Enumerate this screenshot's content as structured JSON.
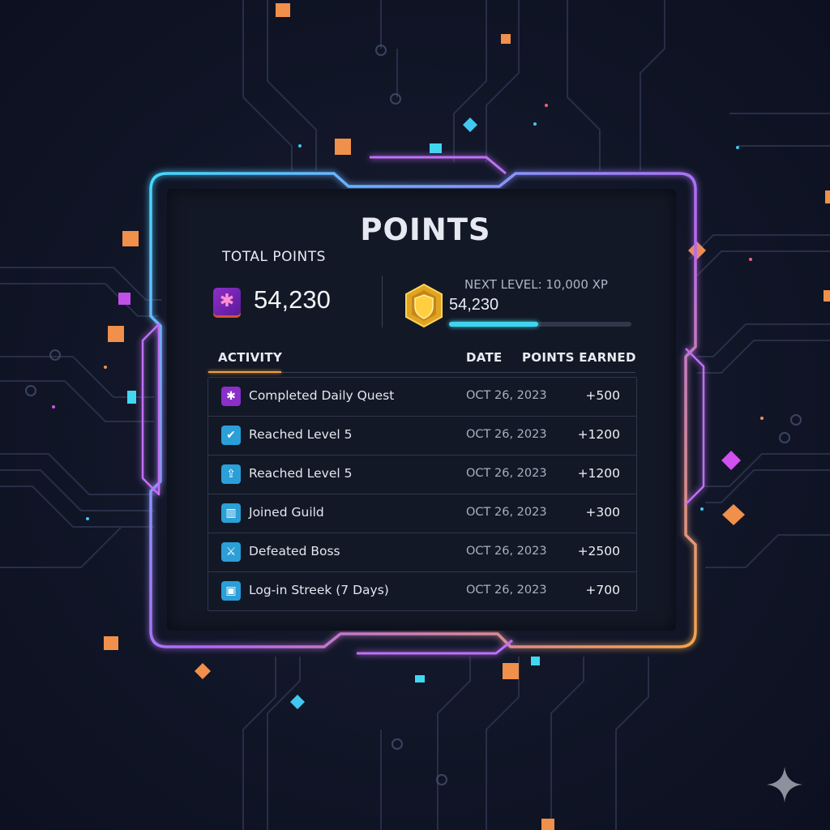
{
  "title": "POINTS",
  "total": {
    "label": "TOTAL POINTS",
    "value": "54,230",
    "icon": "purple-star-gem-icon"
  },
  "level": {
    "icon": "gold-shield-icon",
    "next_label": "NEXT LEVEL: 10,000 XP",
    "points": "54,230",
    "progress": 0.49
  },
  "table": {
    "headers": {
      "activity": "ACTIVITY",
      "date": "DATE",
      "points": "POINTS EARNED"
    },
    "rows": [
      {
        "icon": "star-icon",
        "icon_color": "#8a2fc9",
        "title": "Completed Daily Quest",
        "date": "OCT 26, 2023",
        "points": "+500"
      },
      {
        "icon": "check-icon",
        "icon_color": "#2a9fd8",
        "title": "Reached Level 5",
        "date": "OCT 26, 2023",
        "points": "+1200"
      },
      {
        "icon": "level-up-icon",
        "icon_color": "#2a9fd8",
        "title": "Reached Level 5",
        "date": "OCT 26, 2023",
        "points": "+1200"
      },
      {
        "icon": "guild-icon",
        "icon_color": "#2a9fd8",
        "title": "Joined Guild",
        "date": "OCT 26, 2023",
        "points": "+300"
      },
      {
        "icon": "sword-icon",
        "icon_color": "#2a9fd8",
        "title": "Defeated Boss",
        "date": "OCT 26, 2023",
        "points": "+2500"
      },
      {
        "icon": "calendar-icon",
        "icon_color": "#2a9fd8",
        "title": "Log-in Streek (7 Days)",
        "date": "OCT 26, 2023",
        "points": "+700"
      }
    ]
  },
  "colors": {
    "accent_cyan": "#3fd4ee",
    "accent_purple": "#b05cf0",
    "accent_orange": "#f0a040",
    "panel_bg": "#131826"
  }
}
